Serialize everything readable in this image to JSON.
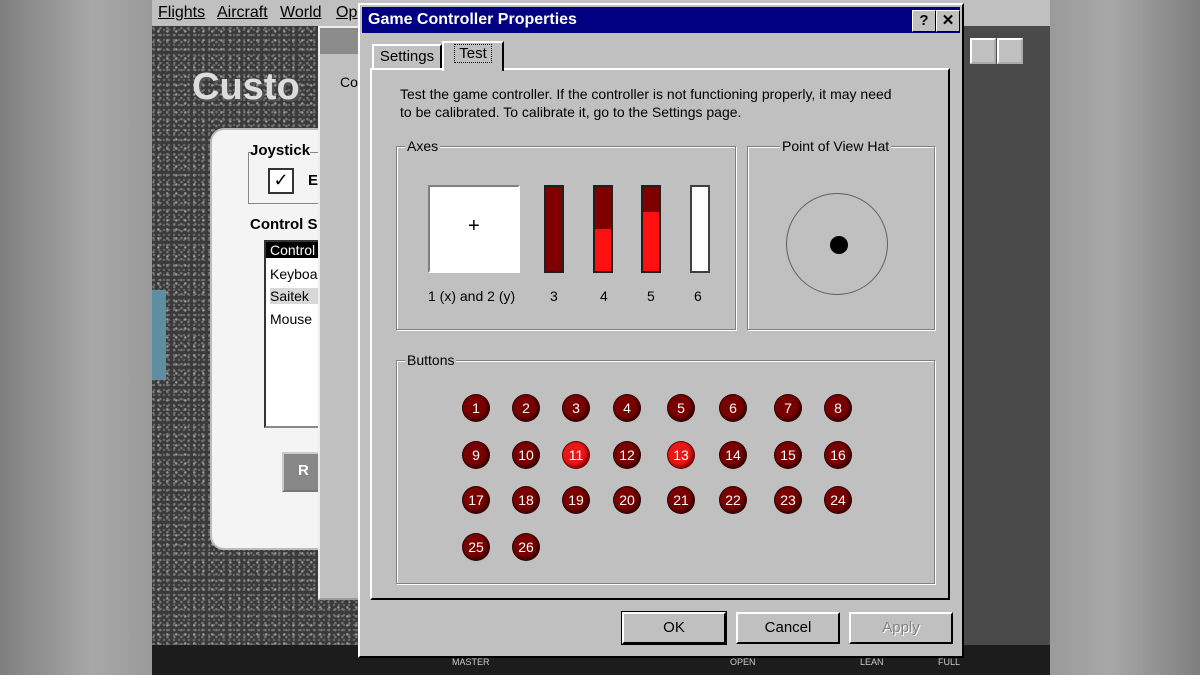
{
  "background_app": {
    "menu": [
      "Flights",
      "Aircraft",
      "World",
      "Op"
    ],
    "title_fragment": "Custo",
    "joystick_group": "Joystick",
    "joystick_check_label": "E",
    "control_group": "Control S",
    "control_list": [
      "Control",
      "Keyboa",
      "Saitek",
      "Mouse"
    ],
    "button_fragment": "R",
    "behind_window_fragment": "Co",
    "bottom_labels": [
      "MASTER",
      "OPEN",
      "LEAN",
      "FULL"
    ]
  },
  "dialog": {
    "title": "Game Controller Properties",
    "help_btn": "?",
    "close_btn": "✕",
    "tabs": [
      {
        "label": "Settings",
        "active": false
      },
      {
        "label": "Test",
        "active": true
      }
    ],
    "description_line1": "Test the game controller.  If the controller is not functioning properly, it may need",
    "description_line2": "to be calibrated.  To calibrate it, go to the Settings page.",
    "axes": {
      "label": "Axes",
      "xy_label": "1 (x) and 2 (y)",
      "crosshair": "+",
      "bars": [
        {
          "label": "3",
          "fill": 0.0
        },
        {
          "label": "4",
          "fill": 0.5
        },
        {
          "label": "5",
          "fill": 0.7
        },
        {
          "label": "6",
          "fill": 0.0,
          "white": true
        }
      ]
    },
    "pov": {
      "label": "Point of View Hat"
    },
    "buttons": {
      "label": "Buttons",
      "items": [
        "1",
        "2",
        "3",
        "4",
        "5",
        "6",
        "7",
        "8",
        "9",
        "10",
        "11",
        "12",
        "13",
        "14",
        "15",
        "16",
        "17",
        "18",
        "19",
        "20",
        "21",
        "22",
        "23",
        "24",
        "25",
        "26"
      ],
      "pressed": [
        "11",
        "13"
      ]
    },
    "footer": {
      "ok": "OK",
      "cancel": "Cancel",
      "apply": "Apply"
    }
  },
  "colors": {
    "titlebar": "#000080",
    "button_off": "#7a0000",
    "button_on": "#e81818",
    "axis_fill": "#ff1010",
    "axis_empty": "#800000"
  }
}
